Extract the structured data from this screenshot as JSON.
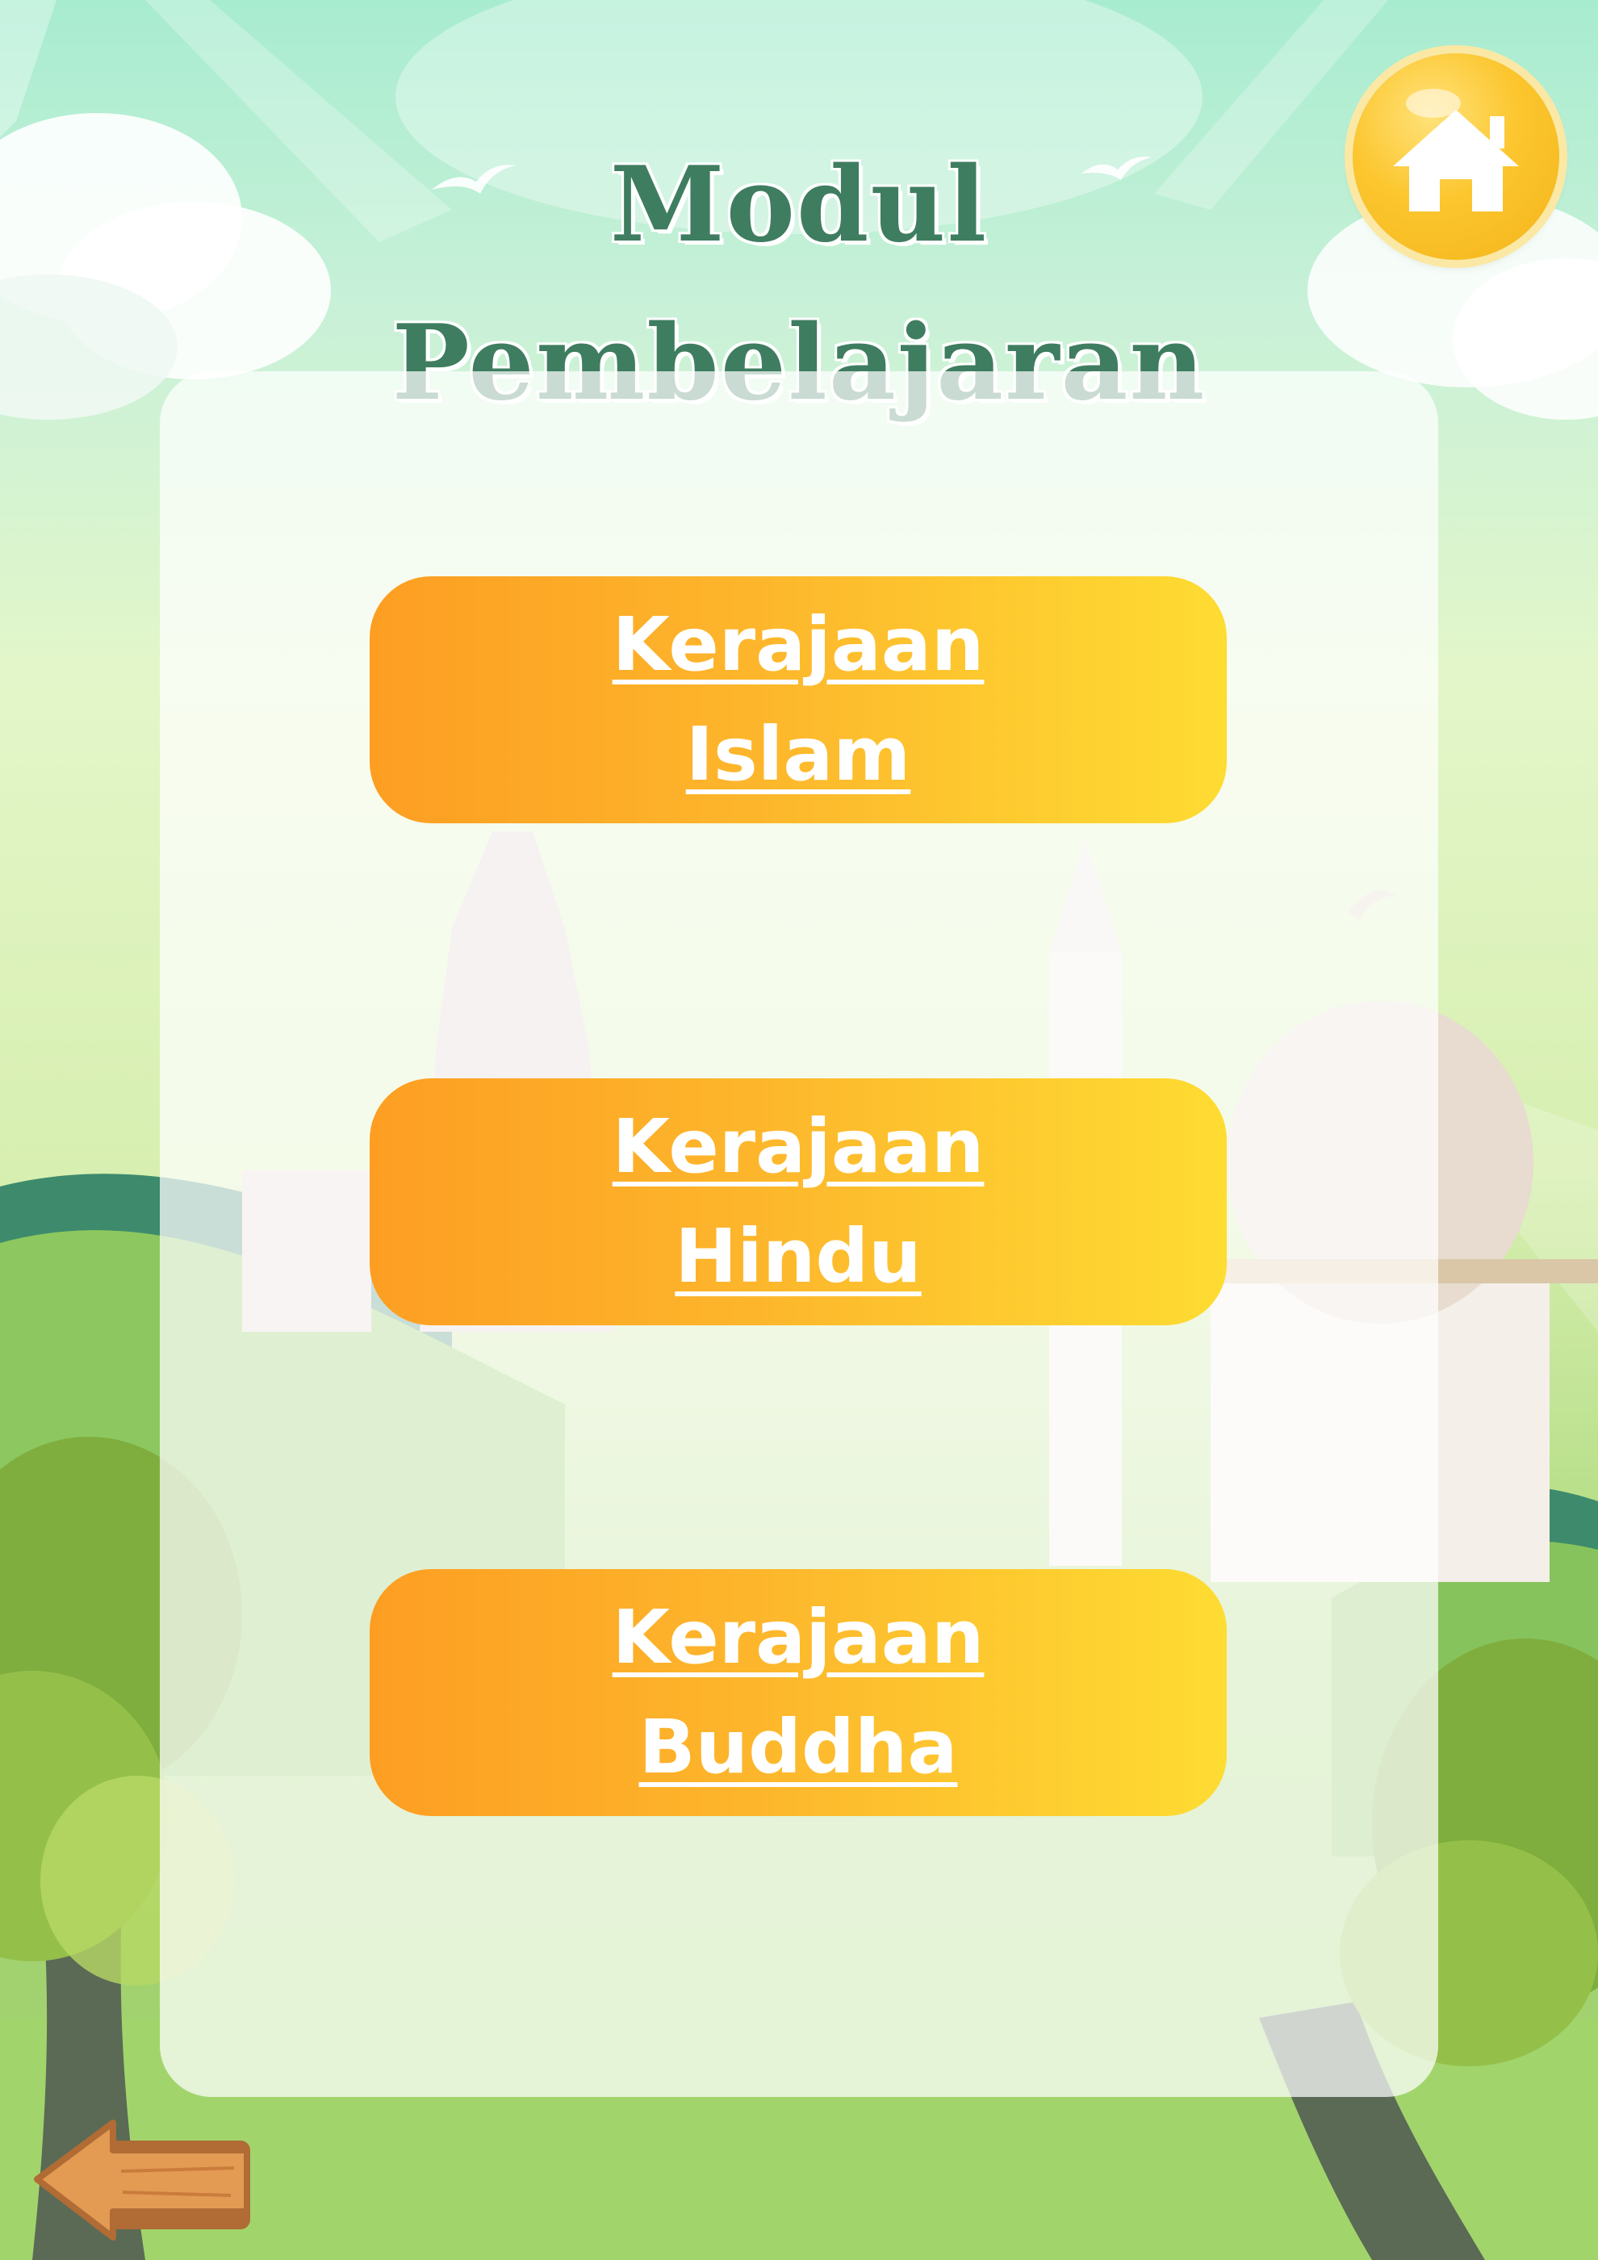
{
  "header": {
    "title_line1": "Modul",
    "title_line2": "Pembelajaran"
  },
  "home_button": {
    "icon": "home-icon"
  },
  "modules": [
    {
      "line1": "Kerajaan",
      "line2": "Islam"
    },
    {
      "line1": "Kerajaan",
      "line2": "Hindu"
    },
    {
      "line1": "Kerajaan",
      "line2": "Buddha"
    }
  ],
  "back_button": {
    "icon": "arrow-left-sign-icon"
  },
  "colors": {
    "title": "#3f7d60",
    "button_gradient_start": "#fd9e22",
    "button_gradient_end": "#fedc32",
    "home_button": "#fcc62e",
    "panel": "#ffffffb8"
  }
}
